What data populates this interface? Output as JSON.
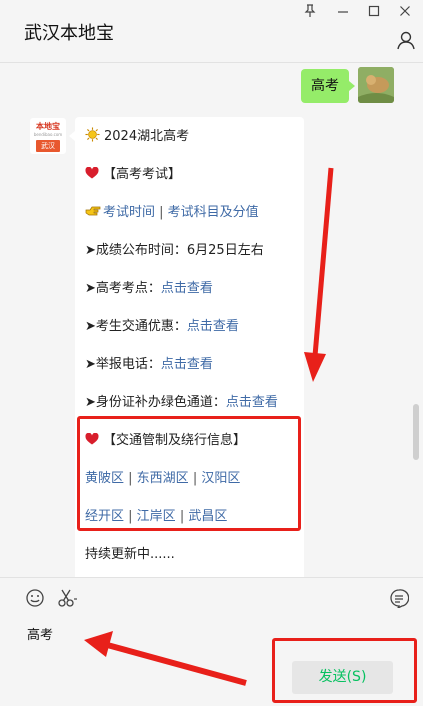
{
  "window": {
    "title": "武汉本地宝"
  },
  "chat": {
    "my_message": "高考",
    "bot_avatar": {
      "brand": "本地宝",
      "city": "武汉"
    },
    "bot_message": {
      "line1": "2024湖北高考",
      "line2": "【高考考试】",
      "line3_link1": "考试时间",
      "line3_link2": "考试科目及分值",
      "line4": "➤成绩公布时间：6月25日左右",
      "line5_label": "➤高考考点：",
      "line5_link": "点击查看",
      "line6_label": "➤考生交通优惠：",
      "line6_link": "点击查看",
      "line7_label": "➤举报电话：",
      "line7_link": "点击查看",
      "line8_label": "➤身份证补办绿色通道：",
      "line8_link": "点击查看",
      "line9": "【交通管制及绕行信息】",
      "line10_links": [
        "黄陂区",
        "东西湖区",
        "汉阳区"
      ],
      "line11_links": [
        "经开区",
        "江岸区",
        "武昌区"
      ],
      "line12": "持续更新中......"
    }
  },
  "input": {
    "text": "高考"
  },
  "send_button": {
    "label": "发送(S)"
  },
  "colors": {
    "accent_green": "#95ec69",
    "link_blue": "#3f6aa6",
    "annotation_red": "#e8201a",
    "send_text": "#07c160"
  },
  "icons": [
    "pin-icon",
    "minimize-icon",
    "maximize-icon",
    "close-icon",
    "person-icon",
    "emoji-icon",
    "scissors-icon",
    "chat-history-icon",
    "sun-icon",
    "heart-icon",
    "pointing-hand-icon"
  ]
}
